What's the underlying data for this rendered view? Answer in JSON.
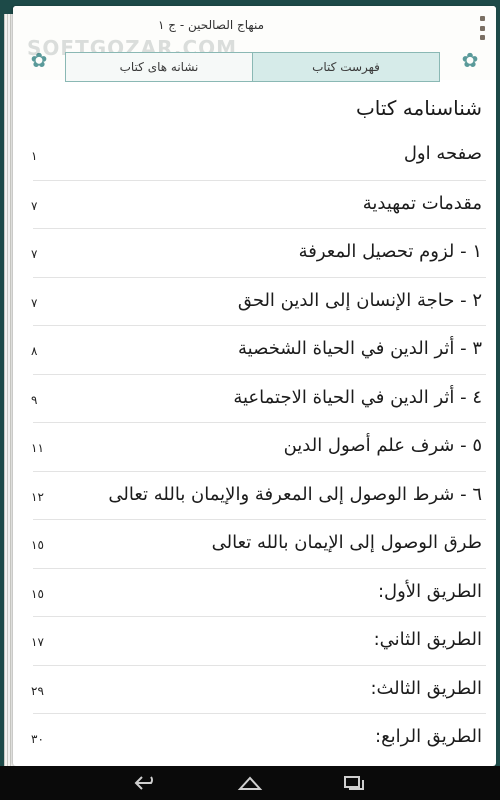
{
  "header": {
    "app_title": "منهاج الصالحين - ج ١",
    "watermark": "SOFTGOZAR.COM",
    "tabs": [
      {
        "label": "فهرست کتاب",
        "active": true
      },
      {
        "label": "نشانه های کتاب",
        "active": false
      }
    ]
  },
  "main": {
    "heading": "شناسنامه کتاب",
    "toc": [
      {
        "title": "صفحه اول",
        "page": "١"
      },
      {
        "title": "مقدمات تمهيدية",
        "page": "٧"
      },
      {
        "title": "١ - لزوم تحصيل المعرفة",
        "page": "٧"
      },
      {
        "title": "٢ - حاجة الإنسان إلى الدين الحق",
        "page": "٧"
      },
      {
        "title": "٣ - أثر الدين في الحياة الشخصية",
        "page": "٨"
      },
      {
        "title": "٤ - أثر الدين في الحياة الاجتماعية",
        "page": "٩"
      },
      {
        "title": "٥ - شرف علم أصول الدين",
        "page": "١١"
      },
      {
        "title": "٦ - شرط الوصول إلى المعرفة والإيمان بالله تعالى",
        "page": "١٢"
      },
      {
        "title": "طرق الوصول إلى الإيمان بالله تعالى",
        "page": "١٥"
      },
      {
        "title": "الطريق الأول:",
        "page": "١٥"
      },
      {
        "title": "الطريق الثاني:",
        "page": "١٧"
      },
      {
        "title": "الطريق الثالث:",
        "page": "٢٩"
      },
      {
        "title": "الطريق الرابع:",
        "page": "٣٠"
      }
    ]
  },
  "navbar": {
    "icons": [
      "back-icon",
      "home-icon",
      "recent-apps-icon"
    ]
  },
  "colors": {
    "background": "#1d4a48",
    "tab_active": "#d6ebe9",
    "tab_border": "#8ab8b4"
  }
}
